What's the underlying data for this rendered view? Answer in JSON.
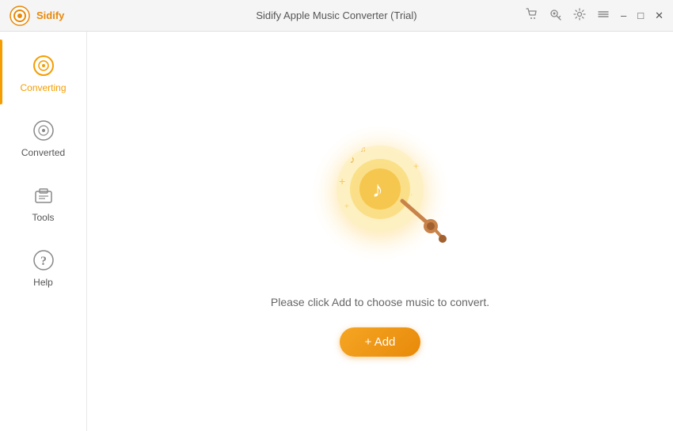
{
  "titleBar": {
    "appName": "Sidify",
    "title": "Sidify Apple Music Converter (Trial)"
  },
  "sidebar": {
    "items": [
      {
        "id": "converting",
        "label": "Converting",
        "active": true
      },
      {
        "id": "converted",
        "label": "Converted",
        "active": false
      },
      {
        "id": "tools",
        "label": "Tools",
        "active": false
      },
      {
        "id": "help",
        "label": "Help",
        "active": false
      }
    ]
  },
  "content": {
    "promptText": "Please click Add to choose music to convert.",
    "addButtonLabel": "+ Add"
  }
}
